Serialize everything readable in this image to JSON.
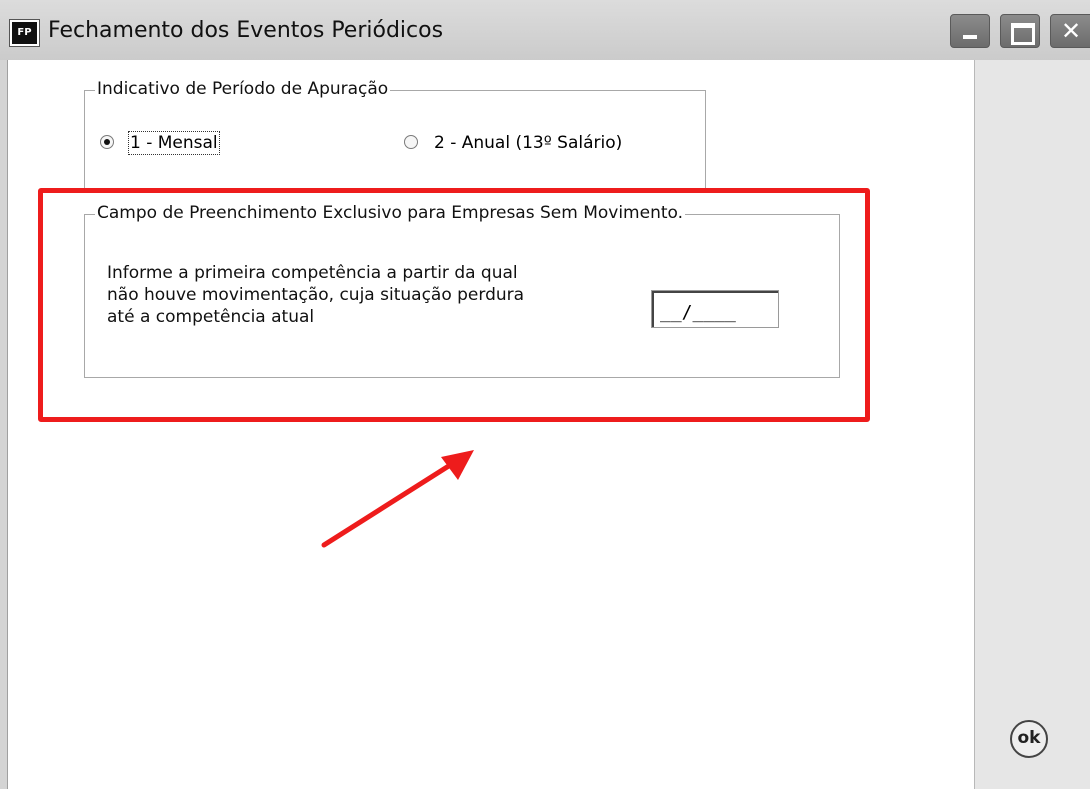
{
  "window": {
    "icon_text": "FP",
    "title": "Fechamento dos Eventos Periódicos",
    "buttons": {
      "minimize": "minimize-icon",
      "maximize": "maximize-icon",
      "close": "close-icon"
    }
  },
  "period_group": {
    "legend": "Indicativo de Período de Apuração",
    "options": [
      {
        "label": "1 - Mensal",
        "selected": true
      },
      {
        "label": "2 - Anual (13º Salário)",
        "selected": false
      }
    ]
  },
  "no_movement_group": {
    "legend": "Campo de Preenchimento Exclusivo para Empresas Sem Movimento.",
    "text_lines": [
      "Informe a primeira competência a partir da  qual",
      "não houve movimentação, cuja situação perdura",
      "até a competência atual"
    ],
    "input_value": "__/____"
  },
  "annotation": {
    "highlight_color": "#ee1c1c"
  },
  "ok_button": {
    "label": "ok"
  }
}
